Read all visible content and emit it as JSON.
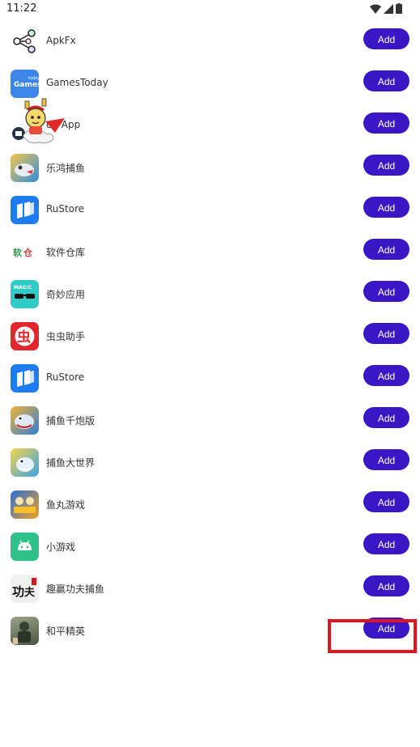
{
  "status_bar": {
    "time": "11:22"
  },
  "apps": [
    {
      "name": "ApkFx",
      "add_label": "Add",
      "icon": "apkfx-network-icon",
      "color": "#ffffff"
    },
    {
      "name": "GamesToday",
      "add_label": "Add",
      "icon": "gamestoday-icon",
      "color": "#3b86e8"
    },
    {
      "name": "on App",
      "add_label": "Add",
      "icon": "app-icon",
      "color": "#f2f2f2"
    },
    {
      "name": "乐鸿捕鱼",
      "add_label": "Add",
      "icon": "fishing-game-icon",
      "color": "#f2a531"
    },
    {
      "name": "RuStore",
      "add_label": "Add",
      "icon": "rustore-icon",
      "color": "#1e7cf2"
    },
    {
      "name": "软件仓库",
      "add_label": "Add",
      "icon": "software-store-icon",
      "color": "#ffffff"
    },
    {
      "name": "奇妙应用",
      "add_label": "Add",
      "icon": "magic-app-icon",
      "color": "#2ecbc7"
    },
    {
      "name": "虫虫助手",
      "add_label": "Add",
      "icon": "chongchong-icon",
      "color": "#e3262c"
    },
    {
      "name": "RuStore",
      "add_label": "Add",
      "icon": "rustore-icon",
      "color": "#1e7cf2"
    },
    {
      "name": "捕鱼千炮版",
      "add_label": "Add",
      "icon": "fishing-cannon-icon",
      "color": "#3a8fe0"
    },
    {
      "name": "捕鱼大世界",
      "add_label": "Add",
      "icon": "fishing-world-icon",
      "color": "#f2c12e"
    },
    {
      "name": "鱼丸游戏",
      "add_label": "Add",
      "icon": "yuwan-game-icon",
      "color": "#2b6fd8"
    },
    {
      "name": "小游戏",
      "add_label": "Add",
      "icon": "android-icon",
      "color": "#2fc18a"
    },
    {
      "name": "趣赢功夫捕鱼",
      "add_label": "Add",
      "icon": "kungfu-fishing-icon",
      "color": "#f0f0f0"
    },
    {
      "name": "和平精英",
      "add_label": "Add",
      "icon": "peace-elite-icon",
      "color": "#6b7a5a"
    }
  ]
}
